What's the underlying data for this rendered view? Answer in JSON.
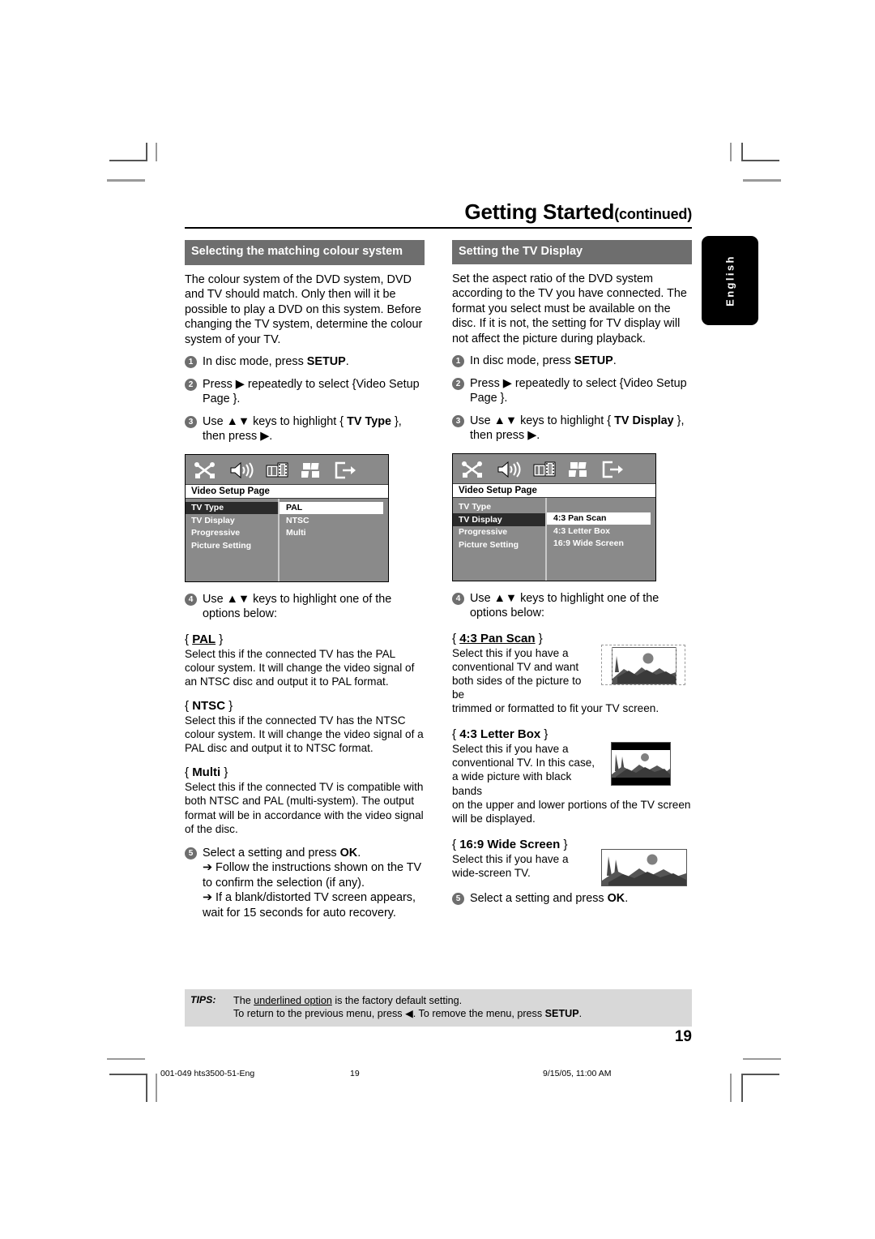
{
  "masthead": {
    "title": "Getting Started",
    "continued": "(continued)"
  },
  "side_tab": {
    "language": "English"
  },
  "left_column": {
    "heading": "Selecting the matching colour system",
    "intro": "The colour system of the DVD system, DVD and TV should match. Only then will it be possible to play a DVD on this system.  Before changing the TV system, determine the colour system of your TV.",
    "steps": [
      {
        "num": "1",
        "text_pre": "In disc mode, press ",
        "bold": "SETUP",
        "text_post": "."
      },
      {
        "num": "2",
        "text_pre": "Press ",
        "symbol": "▶",
        "text_post": " repeatedly to select {Video Setup Page }."
      },
      {
        "num": "3",
        "text_pre": "Use ",
        "symbol": "▲▼",
        "mid": " keys to highlight { ",
        "bold": "TV Type",
        "text_post": " }, then press ▶."
      },
      {
        "num": "4",
        "text_pre": "Use ",
        "symbol": "▲▼",
        "text_post": " keys to highlight one of the options below:"
      },
      {
        "num": "5",
        "text_pre": "Select a setting and press ",
        "bold": "OK",
        "text_post": ".",
        "arrows": [
          "➔ Follow the instructions shown on the TV to confirm the selection (if any).",
          "➔ If a blank/distorted TV screen appears, wait for 15 seconds for auto recovery."
        ]
      }
    ],
    "options": [
      {
        "label": "PAL",
        "underlined": true,
        "body": "Select this if the connected TV has the PAL colour system. It will change the video signal of an NTSC disc and output it to PAL format."
      },
      {
        "label": "NTSC",
        "underlined": false,
        "body": "Select this if the connected TV has the NTSC colour system. It will change the video signal of a PAL disc and output it to NTSC format."
      },
      {
        "label": "Multi",
        "underlined": false,
        "body": "Select this if the connected TV is compatible with both NTSC and PAL (multi-system). The output format will be in accordance with the video signal of the disc."
      }
    ],
    "osd": {
      "page_label": "Video Setup Page",
      "menu_items": [
        "TV Type",
        "TV Display",
        "Progressive",
        "Picture Setting"
      ],
      "selected_menu_index": 0,
      "option_items": [
        "PAL",
        "NTSC",
        "Multi"
      ],
      "selected_option_index": 0,
      "icons": [
        "tools-icon",
        "speaker-icon",
        "film-icon",
        "preference-icon",
        "exit-icon"
      ]
    }
  },
  "right_column": {
    "heading": "Setting the TV Display",
    "intro": "Set the aspect ratio of the DVD system according to the TV you have connected. The format you select must be available on the disc.  If it is not, the setting for TV display will not affect the picture during playback.",
    "steps": [
      {
        "num": "1",
        "text_pre": "In disc mode, press ",
        "bold": "SETUP",
        "text_post": "."
      },
      {
        "num": "2",
        "text_pre": "Press ",
        "symbol": "▶",
        "text_post": " repeatedly to select {Video Setup Page }."
      },
      {
        "num": "3",
        "text_pre": "Use ",
        "symbol": "▲▼",
        "mid": " keys to highlight { ",
        "bold": "TV Display",
        "text_post": " }, then press ▶."
      },
      {
        "num": "4",
        "text_pre": "Use ",
        "symbol": "▲▼",
        "text_post": " keys to highlight one of the options below:"
      },
      {
        "num": "5",
        "text_pre": "Select a setting and press ",
        "bold": "OK",
        "text_post": "."
      }
    ],
    "options": [
      {
        "label": "4:3 Pan Scan",
        "underlined": true,
        "body_wrap": "Select this if you have a conventional TV and want both sides of the picture to be",
        "body_full": "trimmed or formatted to fit your TV screen.",
        "figure": "pan-scan-tv-figure"
      },
      {
        "label": "4:3 Letter Box",
        "underlined": false,
        "body_wrap": "Select this if you have a conventional TV.  In this case, a wide picture with black bands",
        "body_full": "on the upper and lower portions of the TV screen will be displayed.",
        "figure": "letter-box-tv-figure"
      },
      {
        "label": "16:9 Wide Screen",
        "underlined": false,
        "body_wrap": "Select this if you have a wide-screen TV.",
        "body_full": "",
        "figure": "wide-screen-tv-figure"
      }
    ],
    "osd": {
      "page_label": "Video Setup Page",
      "menu_items": [
        "TV Type",
        "TV Display",
        "Progressive",
        "Picture Setting"
      ],
      "selected_menu_index": 1,
      "option_items": [
        "4:3 Pan Scan",
        "4:3 Letter Box",
        "16:9 Wide Screen"
      ],
      "selected_option_index": 0,
      "icons": [
        "tools-icon",
        "speaker-icon",
        "film-icon",
        "preference-icon",
        "exit-icon"
      ]
    }
  },
  "tips": {
    "label": "TIPS:",
    "line1_pre": "The ",
    "line1_underline": "underlined option",
    "line1_post": " is the factory default setting.",
    "line2_pre": "To return to the previous menu, press ◀.  To remove the menu, press ",
    "line2_bold": "SETUP",
    "line2_post": "."
  },
  "page_number": "19",
  "printer_footer": {
    "file": "001-049 hts3500-51-Eng",
    "page": "19",
    "timestamp": "9/15/05, 11:00 AM"
  },
  "colors": {
    "section_header_bg": "#6e6e6e",
    "tips_bg": "#d8d8d8",
    "osd_bg": "#8a8a8a",
    "osd_selected": "#2b2b2b",
    "tab_bg": "#000000"
  }
}
